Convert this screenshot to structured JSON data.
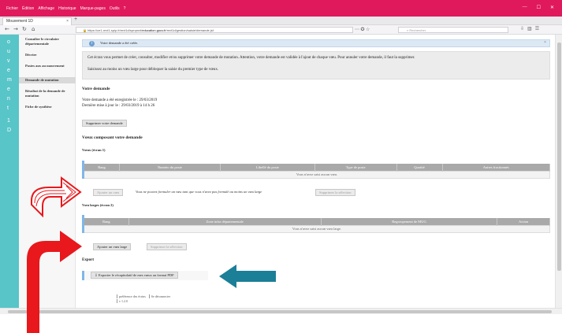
{
  "browser": {
    "menu": [
      "Fichier",
      "Édition",
      "Affichage",
      "Historique",
      "Marque-pages",
      "Outils",
      "?"
    ],
    "tab_title": "Mouvement 1D",
    "url_prefix": "https://ce1-mvt1-spip.fr/mvt1d/sprqmvt/",
    "url_bold": "education.gouv.fr",
    "url_suffix": "/mvt1d/gestion/saisie/demande.jsf",
    "search_placeholder": "Rechercher",
    "zoom": "⋯ ✪ ☆"
  },
  "teal_letters": [
    "o",
    "u",
    "v",
    "e",
    "m",
    "e",
    "n",
    "t",
    "",
    "1",
    "D"
  ],
  "menu": {
    "items": [
      {
        "label": "Consulter le circulaire départementale",
        "active": false
      },
      {
        "label": "Décrire",
        "active": false
      },
      {
        "label": "Postes aux au mouvement",
        "active": false
      },
      {
        "label": "Demande de mutation",
        "active": true
      },
      {
        "label": "Résultat de la demande de mutation",
        "active": false
      },
      {
        "label": "Fiche de synthèse",
        "active": false
      }
    ]
  },
  "notice": {
    "text": "Votre demande a été créée.",
    "close": "×"
  },
  "help": {
    "p1": "Cet écran vous permet de créer, consulter, modifier et/ou supprimer votre demande de mutation. Attention, votre demande est validée à l'ajout de chaque vœu. Pour annuler votre demande, il faut la supprimer.",
    "p2": "Saisissez au moins un vœu large pour débloquer la saisie du premier type de vœux."
  },
  "demande": {
    "title": "Votre demande",
    "line1": "Votre demande a été enregistrée le : 29/03/2019",
    "line2": "Dernière mise à jour le : 29/03/2019 à 14 h 26",
    "delete_button": "Supprimer votre demande"
  },
  "voeux_section": {
    "title": "Vœux composant votre demande",
    "voeux_label": "Vœux (écran 1)",
    "voeux_columns": [
      "Rang",
      "Numéro du poste",
      "Libellé du poste",
      "Type de poste",
      "Quotité",
      "Autres fractionnés"
    ],
    "voeux_empty": "Vous n'avez saisi aucun vœu.",
    "add_voeu_button": "Ajouter un vœu",
    "voeux_note": "Vous ne pouvez formuler un vœu tant que vous n'avez pas formulé au moins un vœu large",
    "delete_selection_button": "Supprimer la sélection",
    "larges_label": "Vœu larges (écran 2)",
    "larges_columns": [
      "Rang",
      "Zone infra départementale",
      "Regroupement de MUG",
      "Action"
    ],
    "larges_empty": "Vous n'avez saisi aucun vœu large.",
    "add_large_button": "Ajouter un vœu large",
    "delete_selection_button2": "Supprimer la sélection"
  },
  "export": {
    "title": "Export",
    "button": "Exporter le récapitulatif de mes vœux au format PDF"
  },
  "footer": {
    "link1": "préférence des écrins",
    "link2": "Se déconnecter",
    "version": "v 1.2.0"
  },
  "colors": {
    "brand_pink": "#e0195d",
    "teal": "#58c5c8",
    "arrow_red": "#e8181c",
    "arrow_blue": "#1b7f98",
    "accent_blue": "#7fb7e8"
  }
}
